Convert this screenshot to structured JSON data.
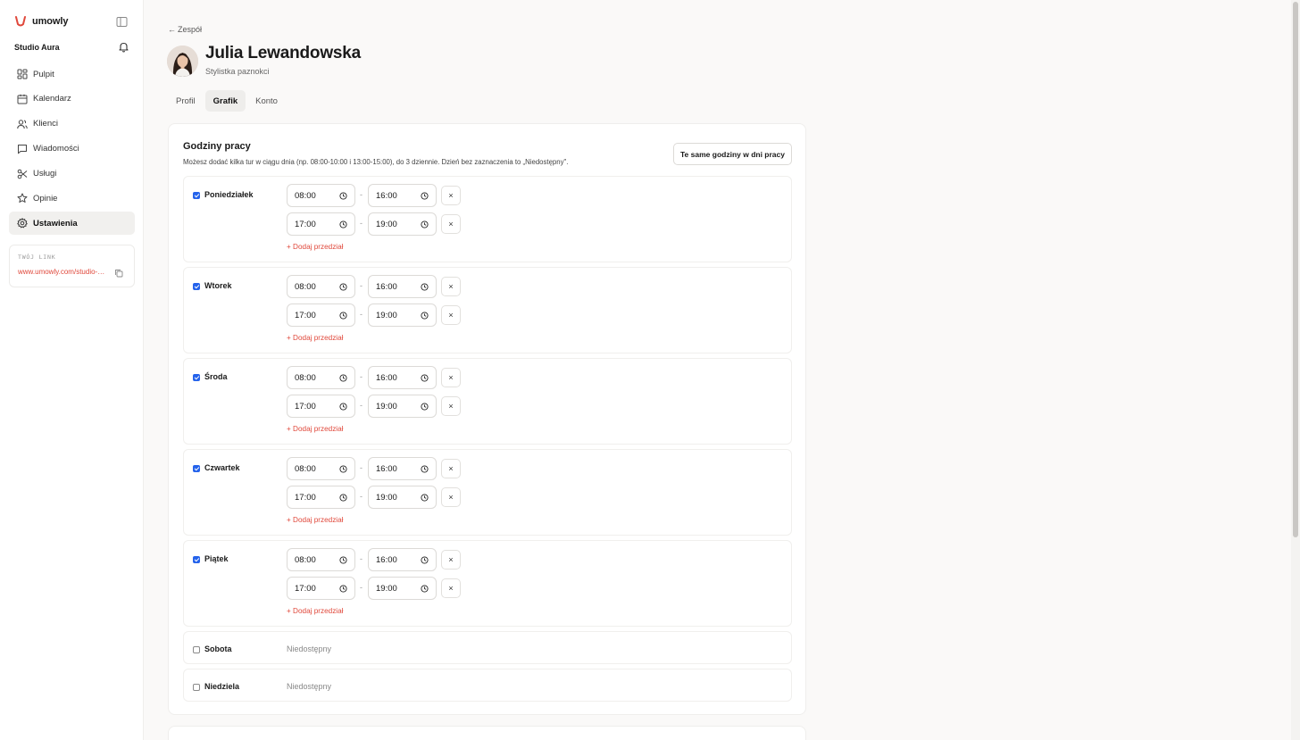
{
  "brand": {
    "name": "umowly",
    "logo_color": "#e0483b"
  },
  "sidebar": {
    "studio_name": "Studio Aura",
    "items": [
      {
        "label": "Pulpit",
        "icon": "dashboard-icon",
        "active": false
      },
      {
        "label": "Kalendarz",
        "icon": "calendar-icon",
        "active": false
      },
      {
        "label": "Klienci",
        "icon": "users-icon",
        "active": false
      },
      {
        "label": "Wiadomości",
        "icon": "message-icon",
        "active": false
      },
      {
        "label": "Usługi",
        "icon": "scissors-icon",
        "active": false
      },
      {
        "label": "Opinie",
        "icon": "star-icon",
        "active": false
      },
      {
        "label": "Ustawienia",
        "icon": "gear-icon",
        "active": true
      }
    ],
    "link_card": {
      "label": "TWÓJ LINK",
      "url": "www.umowly.com/studio-aura"
    }
  },
  "header": {
    "back_label": "Zespół",
    "name": "Julia Lewandowska",
    "role": "Stylistka paznokci"
  },
  "tabs": [
    {
      "label": "Profil",
      "active": false
    },
    {
      "label": "Grafik",
      "active": true
    },
    {
      "label": "Konto",
      "active": false
    }
  ],
  "schedule": {
    "title": "Godziny pracy",
    "description": "Możesz dodać kilka tur w ciągu dnia (np. 08:00-10:00 i 13:00-15:00), do 3 dziennie. Dzień bez zaznaczenia to „Niedostępny\".",
    "same_hours_button": "Te same godziny w dni pracy",
    "add_range_label": "+ Dodaj przedział",
    "unavailable_label": "Niedostępny",
    "remove_label": "×",
    "range_separator": "-",
    "days": [
      {
        "name": "Poniedziałek",
        "enabled": true,
        "ranges": [
          {
            "from": "08:00",
            "to": "16:00"
          },
          {
            "from": "17:00",
            "to": "19:00"
          }
        ]
      },
      {
        "name": "Wtorek",
        "enabled": true,
        "ranges": [
          {
            "from": "08:00",
            "to": "16:00"
          },
          {
            "from": "17:00",
            "to": "19:00"
          }
        ]
      },
      {
        "name": "Środa",
        "enabled": true,
        "ranges": [
          {
            "from": "08:00",
            "to": "16:00"
          },
          {
            "from": "17:00",
            "to": "19:00"
          }
        ]
      },
      {
        "name": "Czwartek",
        "enabled": true,
        "ranges": [
          {
            "from": "08:00",
            "to": "16:00"
          },
          {
            "from": "17:00",
            "to": "19:00"
          }
        ]
      },
      {
        "name": "Piątek",
        "enabled": true,
        "ranges": [
          {
            "from": "08:00",
            "to": "16:00"
          },
          {
            "from": "17:00",
            "to": "19:00"
          }
        ]
      },
      {
        "name": "Sobota",
        "enabled": false,
        "ranges": []
      },
      {
        "name": "Niedziela",
        "enabled": false,
        "ranges": []
      }
    ]
  }
}
